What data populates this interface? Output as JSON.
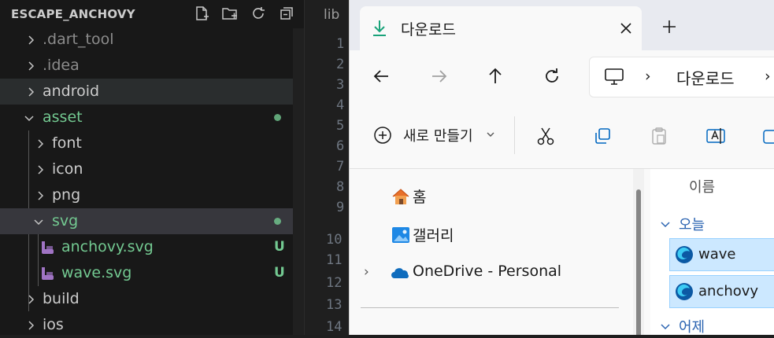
{
  "vscode": {
    "explorer_title": "ESCAPE_ANCHOVY",
    "header_icons": [
      "new-file-icon",
      "new-folder-icon",
      "refresh-icon",
      "collapse-all-icon"
    ],
    "tree": [
      {
        "label": ".dart_tool",
        "state": "collapsed",
        "style": "dim"
      },
      {
        "label": ".idea",
        "state": "collapsed",
        "style": "dim"
      },
      {
        "label": "android",
        "state": "collapsed",
        "style": "normal"
      },
      {
        "label": "asset",
        "state": "expanded",
        "style": "green"
      },
      {
        "label": "font",
        "state": "collapsed",
        "style": "normal"
      },
      {
        "label": "icon",
        "state": "collapsed",
        "style": "normal"
      },
      {
        "label": "png",
        "state": "collapsed",
        "style": "normal"
      },
      {
        "label": "svg",
        "state": "expanded",
        "style": "green"
      },
      {
        "label": "anchovy.svg",
        "status": "U"
      },
      {
        "label": "wave.svg",
        "status": "U"
      },
      {
        "label": "build",
        "state": "collapsed",
        "style": "normal"
      },
      {
        "label": "ios",
        "state": "collapsed",
        "style": "normal"
      }
    ],
    "editor_breadcrumb": "lib",
    "line_numbers": [
      "1",
      "2",
      "3",
      "4",
      "5",
      "6",
      "7",
      "8",
      "9",
      "10",
      "11",
      "12",
      "13",
      "14"
    ]
  },
  "file_explorer": {
    "tab_title": "다운로드",
    "new_tab_label": "+",
    "address_segments": [
      "다운로드"
    ],
    "toolbar": {
      "new_label": "새로 만들기"
    },
    "nav": {
      "home_label": "홈",
      "gallery_label": "갤러리",
      "onedrive_label": "OneDrive - Personal"
    },
    "content": {
      "column_name": "이름",
      "group_today": "오늘",
      "files": [
        "wave",
        "anchovy"
      ],
      "group_yesterday": "어제"
    },
    "colors": {
      "accent": "#0067c0",
      "selection": "#cce8ff",
      "green": "#73c991"
    }
  }
}
